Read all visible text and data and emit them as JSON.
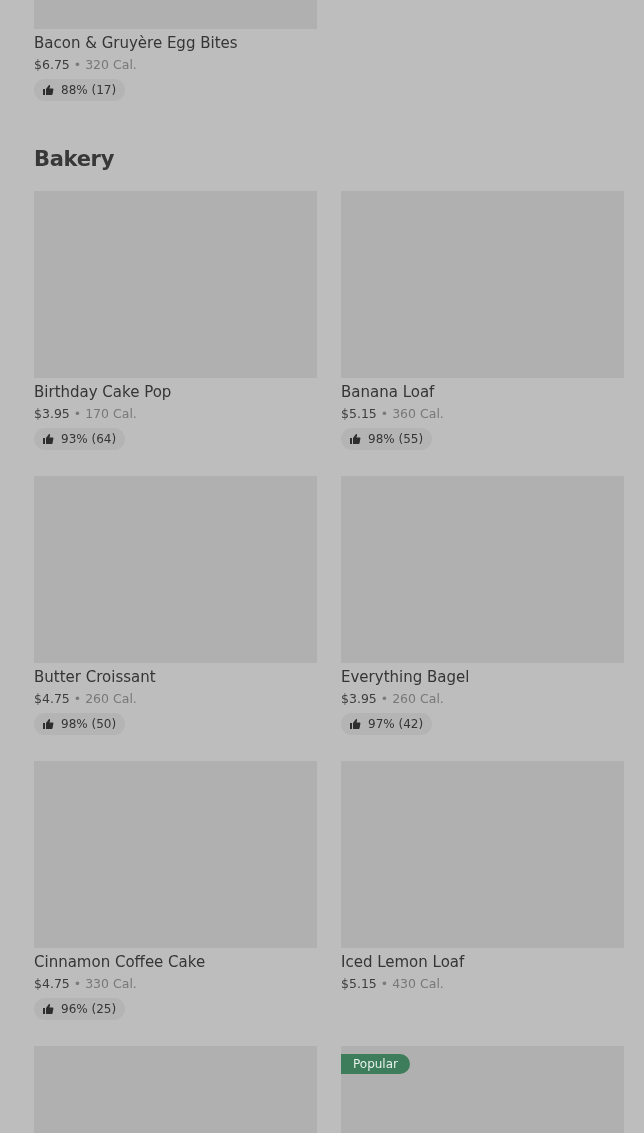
{
  "sections": [
    {
      "items": [
        {
          "kind": "product",
          "name": "Bacon & Gruyère Egg Bites",
          "price": "$6.75",
          "separator": "•",
          "calories": "320 Cal.",
          "rating": "88% (17)",
          "image_cut": true
        }
      ]
    },
    {
      "title": "Bakery",
      "items": [
        {
          "kind": "product",
          "name": "Birthday Cake Pop",
          "price": "$3.95",
          "separator": "•",
          "calories": "170 Cal.",
          "rating": "93% (64)",
          "image_cut": false
        },
        {
          "kind": "product",
          "name": "Banana Loaf",
          "price": "$5.15",
          "separator": "•",
          "calories": "360 Cal.",
          "rating": "98% (55)",
          "image_cut": false
        },
        {
          "kind": "product",
          "name": "Butter Croissant",
          "price": "$4.75",
          "separator": "•",
          "calories": "260 Cal.",
          "rating": "98% (50)",
          "image_cut": false
        },
        {
          "kind": "product",
          "name": "Everything Bagel",
          "price": "$3.95",
          "separator": "•",
          "calories": "260 Cal.",
          "rating": "97% (42)",
          "image_cut": false
        },
        {
          "kind": "product",
          "name": "Cinnamon Coffee Cake",
          "price": "$4.75",
          "separator": "•",
          "calories": "330 Cal.",
          "rating": "96% (25)",
          "image_cut": false
        },
        {
          "kind": "product",
          "name": "Iced Lemon Loaf",
          "price": "$5.15",
          "separator": "•",
          "calories": "430 Cal.",
          "image_cut": false
        },
        {
          "kind": "picture",
          "image_cut": false
        },
        {
          "kind": "picture",
          "badge": "Popular",
          "image_cut": false
        }
      ]
    }
  ]
}
